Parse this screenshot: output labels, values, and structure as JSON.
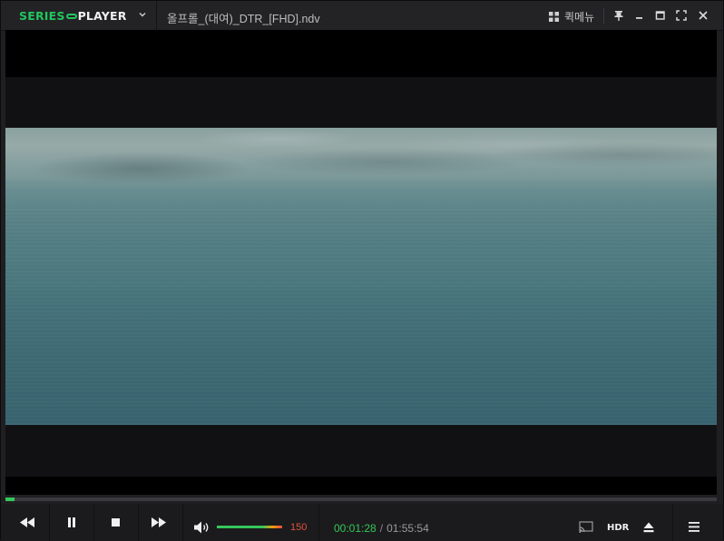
{
  "app": {
    "logo": {
      "part1": "SERIES",
      "part2": "PLAYER"
    },
    "file_name": "올프롤_(대여)_DTR_[FHD].ndv",
    "quick_menu_label": "퀵메뉴"
  },
  "playback": {
    "current_time": "00:01:28",
    "time_separator": "/",
    "total_time": "01:55:54",
    "progress_fraction": 0.0127,
    "volume_level": "150",
    "volume_fraction": 1.0,
    "hdr_label": "HDR",
    "state": "playing"
  },
  "colors": {
    "accent_green": "#34c759",
    "volume_red": "#e0533a",
    "background": "#1b1b1d"
  },
  "icons": [
    "chevron-down-icon",
    "quick-menu-grid-icon",
    "pin-icon",
    "minimize-icon",
    "maximize-icon",
    "fullscreen-icon",
    "close-icon",
    "rewind-icon",
    "pause-icon",
    "stop-icon",
    "fast-forward-icon",
    "speaker-icon",
    "cast-icon",
    "eject-icon",
    "menu-icon"
  ]
}
